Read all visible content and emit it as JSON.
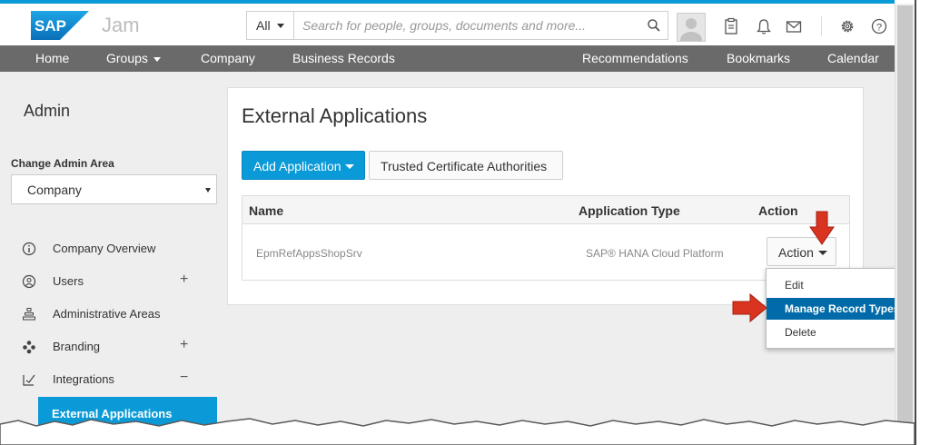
{
  "brand": {
    "name": "SAP",
    "product": "Jam",
    "accent": "#0a9ad8"
  },
  "search": {
    "scope": "All",
    "placeholder": "Search for people, groups, documents and more..."
  },
  "header_icons": [
    "avatar",
    "clipboard-icon",
    "bell-icon",
    "envelope-icon",
    "gear-icon",
    "help-icon"
  ],
  "nav": {
    "home": "Home",
    "groups": "Groups",
    "company": "Company",
    "business_records": "Business Records",
    "recommendations": "Recommendations",
    "bookmarks": "Bookmarks",
    "calendar": "Calendar"
  },
  "sidebar": {
    "title": "Admin",
    "change_area_label": "Change Admin Area",
    "selected_area": "Company",
    "items": [
      {
        "label": "Company Overview",
        "icon": "info-icon",
        "expand": ""
      },
      {
        "label": "Users",
        "icon": "user-icon",
        "expand": "+"
      },
      {
        "label": "Administrative Areas",
        "icon": "hierarchy-icon",
        "expand": ""
      },
      {
        "label": "Branding",
        "icon": "palette-icon",
        "expand": "+"
      },
      {
        "label": "Integrations",
        "icon": "integration-icon",
        "expand": "−"
      }
    ],
    "active_subitem": "External Applications"
  },
  "main": {
    "title": "External Applications",
    "add_button": "Add Application",
    "trusted_button": "Trusted Certificate Authorities",
    "table": {
      "columns": [
        "Name",
        "Application Type",
        "Action"
      ],
      "rows": [
        {
          "name": "EpmRefAppsShopSrv",
          "type": "SAP® HANA Cloud Platform",
          "action": "Action"
        }
      ]
    },
    "action_menu": {
      "items": [
        "Edit",
        "Manage Record Types",
        "Delete"
      ],
      "selected": "Manage Record Types",
      "highlight_color": "#006ba8"
    }
  },
  "annotation_color": "#d9341f"
}
